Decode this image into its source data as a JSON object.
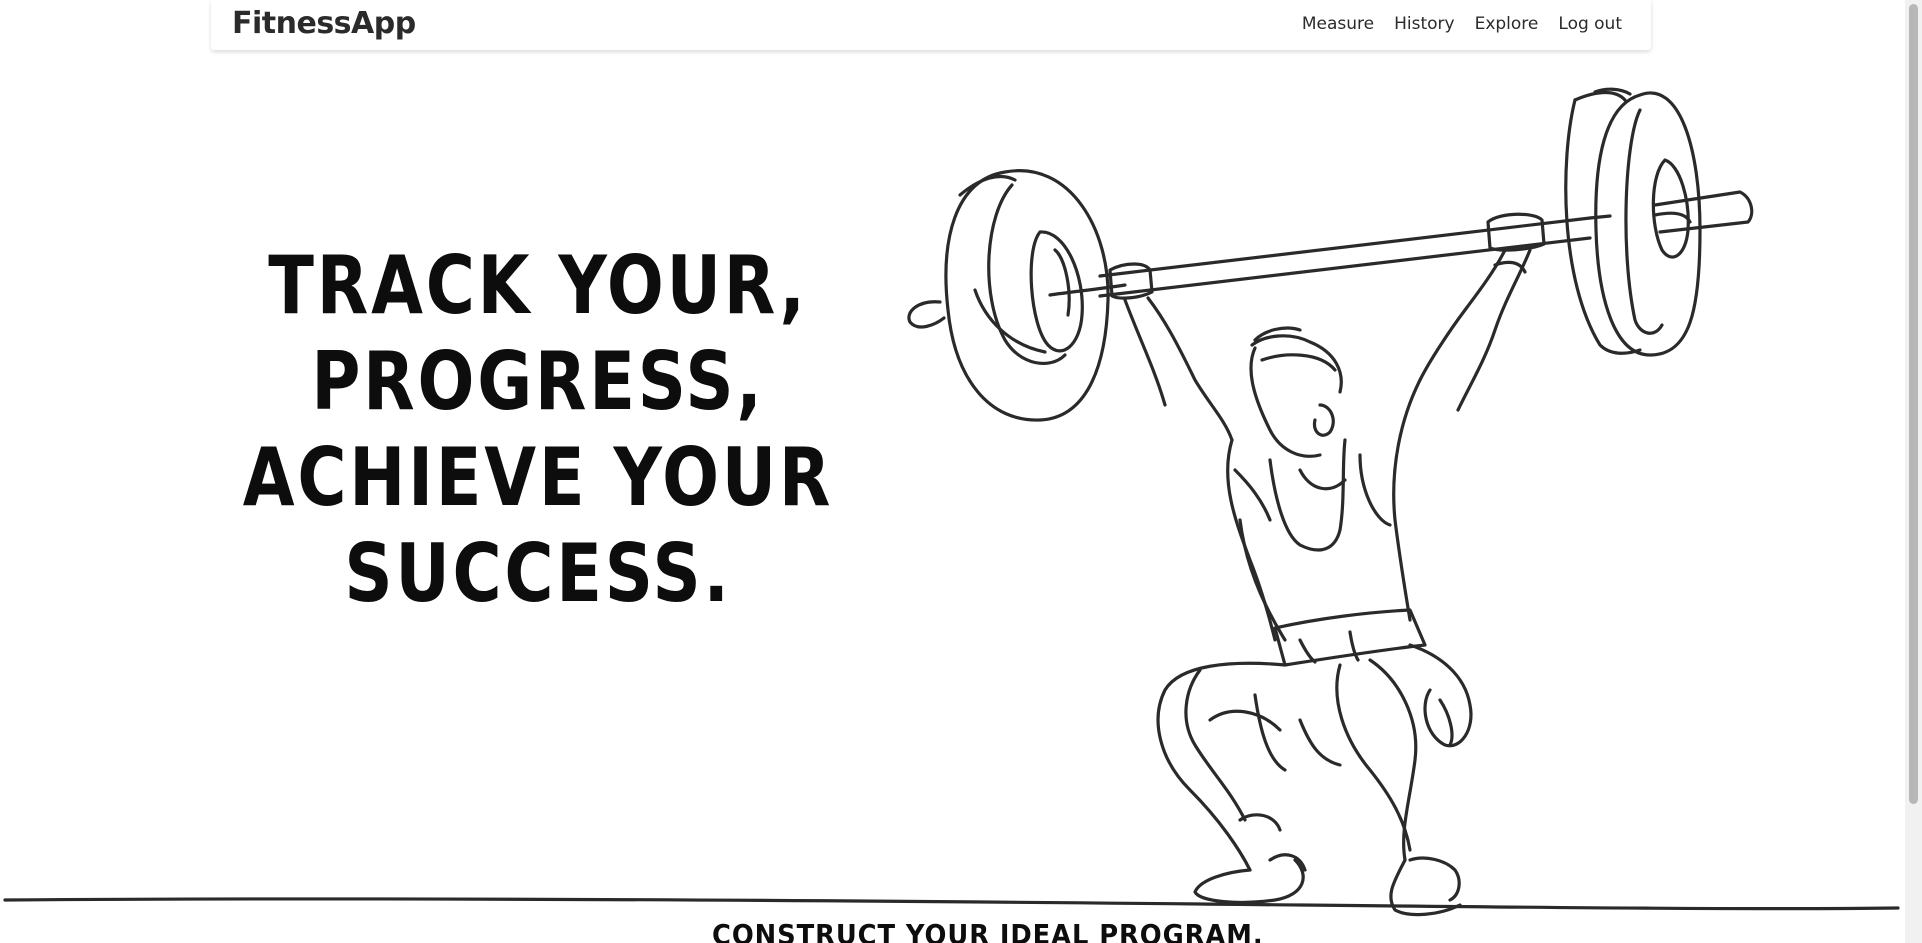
{
  "navbar": {
    "brand": "FitnessApp",
    "links": [
      {
        "label": "Measure"
      },
      {
        "label": "History"
      },
      {
        "label": "Explore"
      },
      {
        "label": "Log out"
      }
    ]
  },
  "hero": {
    "lines": [
      "TRACK YOUR,",
      "PROGRESS,",
      "ACHIEVE YOUR",
      "SUCCESS."
    ],
    "illustration_icon": "weightlifter-line-art-icon"
  },
  "next_section": {
    "heading": "CONSTRUCT YOUR IDEAL PROGRAM."
  },
  "colors": {
    "background": "#ffffff",
    "text": "#0d0d0d",
    "line_art": "#2a2a2a"
  }
}
